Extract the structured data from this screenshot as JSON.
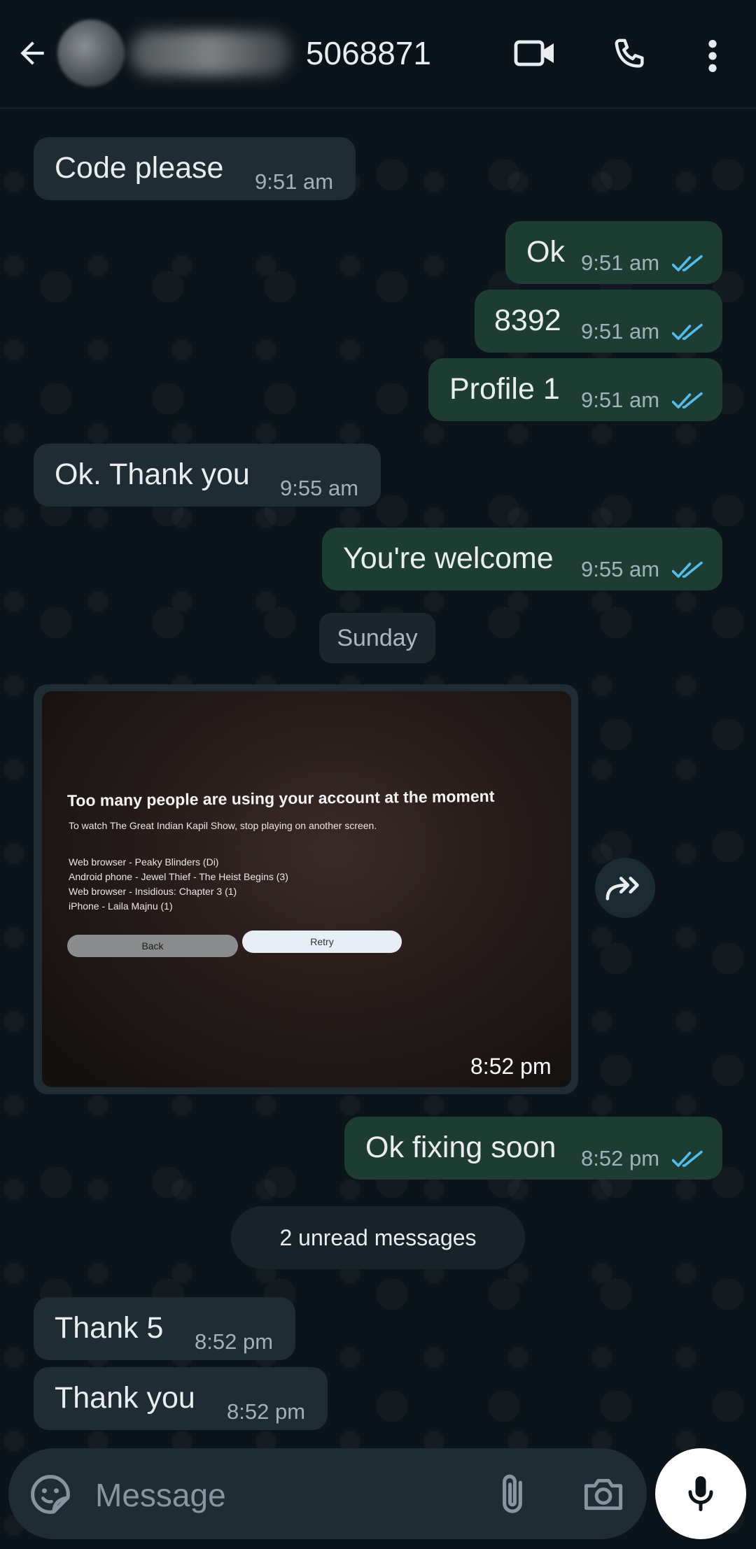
{
  "header": {
    "contact_name": "5068871",
    "icons": [
      "back-arrow-icon",
      "video-camera-icon",
      "phone-icon",
      "more-vert-icon"
    ]
  },
  "messages": [
    {
      "direction": "in",
      "text": "Code please",
      "time": "9:51 am"
    },
    {
      "direction": "out",
      "text": "Ok",
      "time": "9:51 am",
      "status": "read"
    },
    {
      "direction": "out",
      "text": "8392",
      "time": "9:51 am",
      "status": "read"
    },
    {
      "direction": "out",
      "text": "Profile 1",
      "time": "9:51 am",
      "status": "read"
    },
    {
      "direction": "in",
      "text": "Ok. Thank you",
      "time": "9:55 am"
    },
    {
      "direction": "out",
      "text": "You're welcome",
      "time": "9:55 am",
      "status": "read"
    }
  ],
  "day_separator": "Sunday",
  "image_message": {
    "direction": "in",
    "time": "8:52 pm",
    "photo": {
      "title": "Too many people are using your account at the moment",
      "subtitle": "To watch The Great Indian Kapil Show, stop playing on another screen.",
      "devices": [
        "Web browser - Peaky Blinders (Di)",
        "Android phone - Jewel Thief - The Heist Begins (3)",
        "Web browser - Insidious: Chapter 3 (1)",
        "iPhone - Laila Majnu (1)"
      ],
      "back_label": "Back",
      "retry_label": "Retry"
    }
  },
  "after_image": {
    "direction": "out",
    "text": "Ok fixing soon",
    "time": "8:52 pm",
    "status": "read"
  },
  "unread_label": "2 unread messages",
  "unread_messages": [
    {
      "direction": "in",
      "text": "Thank 5",
      "time": "8:52 pm"
    },
    {
      "direction": "in",
      "text": "Thank you",
      "time": "8:52 pm"
    }
  ],
  "composer": {
    "placeholder": "Message"
  },
  "colors": {
    "background": "#0b141a",
    "incoming_bubble": "#202c33",
    "outgoing_bubble": "#1e3d32",
    "read_ticks": "#53bdeb"
  }
}
